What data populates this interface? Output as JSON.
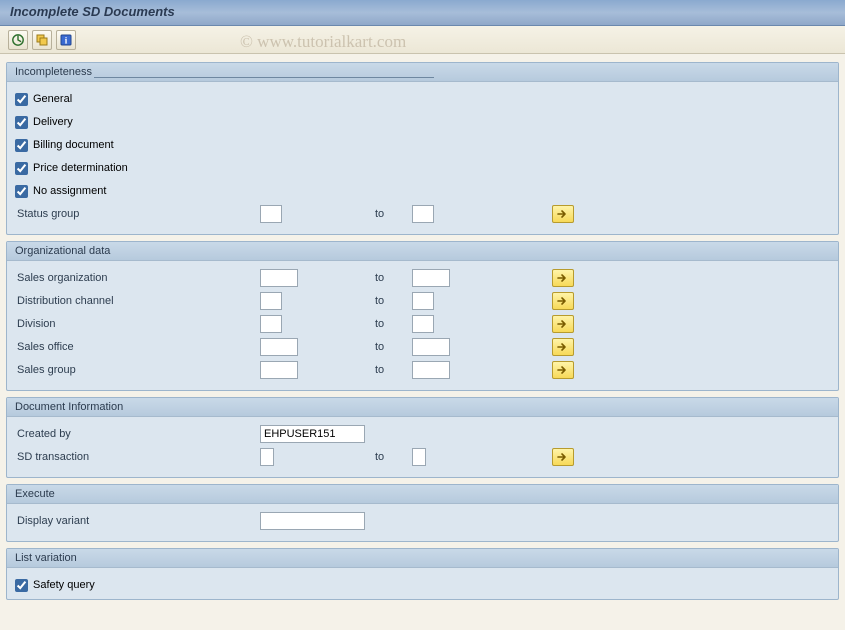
{
  "title": "Incomplete SD Documents",
  "watermark": "© www.tutorialkart.com",
  "toolbar": {
    "icon1": "clock-icon",
    "icon2": "variant-icon",
    "icon3": "info-icon"
  },
  "groups": {
    "incompleteness": {
      "header": "Incompleteness",
      "checks": {
        "general": "General",
        "delivery": "Delivery",
        "billing": "Billing document",
        "price": "Price determination",
        "noassign": "No assignment"
      },
      "status_group_label": "Status group",
      "to_label": "to"
    },
    "orgdata": {
      "header": "Organizational data",
      "to_label": "to",
      "rows": {
        "sales_org": "Sales organization",
        "dist_channel": "Distribution channel",
        "division": "Division",
        "sales_office": "Sales office",
        "sales_group": "Sales group"
      }
    },
    "docinfo": {
      "header": "Document Information",
      "created_by_label": "Created by",
      "created_by_value": "EHPUSER151",
      "sd_tx_label": "SD transaction",
      "to_label": "to"
    },
    "execute": {
      "header": "Execute",
      "display_variant_label": "Display variant"
    },
    "listvar": {
      "header": "List variation",
      "safety_query": "Safety query"
    }
  }
}
